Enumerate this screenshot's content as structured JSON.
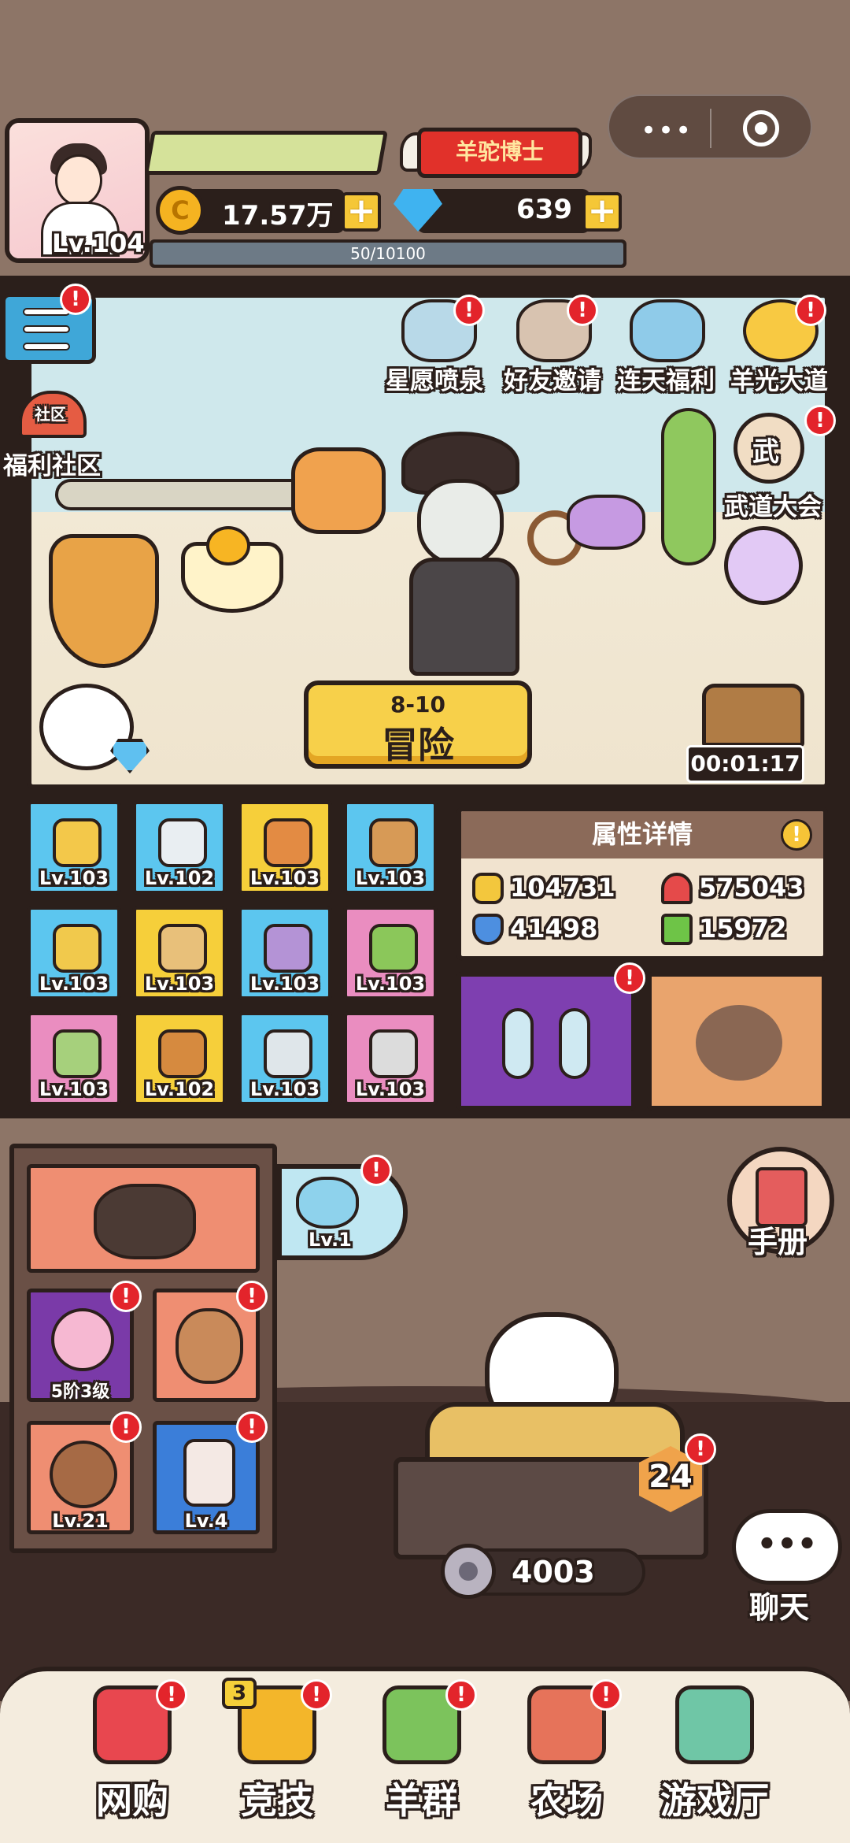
{
  "header": {
    "level_label": "Lv.104",
    "title_badge": "羊驼博士",
    "gold": "17.57万",
    "gems": "639",
    "xp": "50/10100"
  },
  "scene": {
    "features": [
      {
        "label": "星愿喷泉",
        "icon": "fountain-icon"
      },
      {
        "label": "好友邀请",
        "icon": "friends-icon"
      },
      {
        "label": "连天福利",
        "icon": "gift-icon"
      },
      {
        "label": "羊光大道",
        "icon": "sun-icon"
      }
    ],
    "community_tag": "社区",
    "community_label": "福利社区",
    "martial_label": "武道大会",
    "martial_tag": "武",
    "stage": "8-10",
    "adventure_label": "冒险",
    "timer": "00:01:17"
  },
  "equipment": [
    {
      "level": "Lv.103",
      "color": "#5cc6ef",
      "art": "#f3c84a"
    },
    {
      "level": "Lv.102",
      "color": "#5cc6ef",
      "art": "#e9eef2"
    },
    {
      "level": "Lv.103",
      "color": "#f6cf3a",
      "art": "#e38b43"
    },
    {
      "level": "Lv.103",
      "color": "#5cc6ef",
      "art": "#d79a56"
    },
    {
      "level": "Lv.103",
      "color": "#5cc6ef",
      "art": "#f1c94c"
    },
    {
      "level": "Lv.103",
      "color": "#f6cf3a",
      "art": "#e8c07a"
    },
    {
      "level": "Lv.103",
      "color": "#5cc6ef",
      "art": "#b493d6"
    },
    {
      "level": "Lv.103",
      "color": "#ea8dc0",
      "art": "#8bc75a"
    },
    {
      "level": "Lv.103",
      "color": "#ea8dc0",
      "art": "#a6d07c"
    },
    {
      "level": "Lv.102",
      "color": "#f6cf3a",
      "art": "#d68a3f"
    },
    {
      "level": "Lv.103",
      "color": "#5cc6ef",
      "art": "#dfe6ea"
    },
    {
      "level": "Lv.103",
      "color": "#ea8dc0",
      "art": "#dcdcdc"
    }
  ],
  "attributes": {
    "title": "属性详情",
    "info": "!",
    "attack": "104731",
    "hp": "575043",
    "defense": "41498",
    "speed": "15972"
  },
  "lower": {
    "pet_level": "Lv.1",
    "flower_tier": "5阶3级",
    "hedgehog_level": "Lv.21",
    "jar_level": "Lv.4",
    "handbook": "手册",
    "farm_value": "4003",
    "hex_value": "24",
    "chat": "聊天",
    "chat_bubble": "•••"
  },
  "nav": [
    {
      "label": "网购",
      "color": "#e8474f"
    },
    {
      "label": "竞技",
      "color": "#f3b62a",
      "count": "3"
    },
    {
      "label": "羊群",
      "color": "#7cc35c"
    },
    {
      "label": "农场",
      "color": "#e6735a"
    },
    {
      "label": "游戏厅",
      "color": "#6fc6a6"
    }
  ],
  "alert": "!"
}
